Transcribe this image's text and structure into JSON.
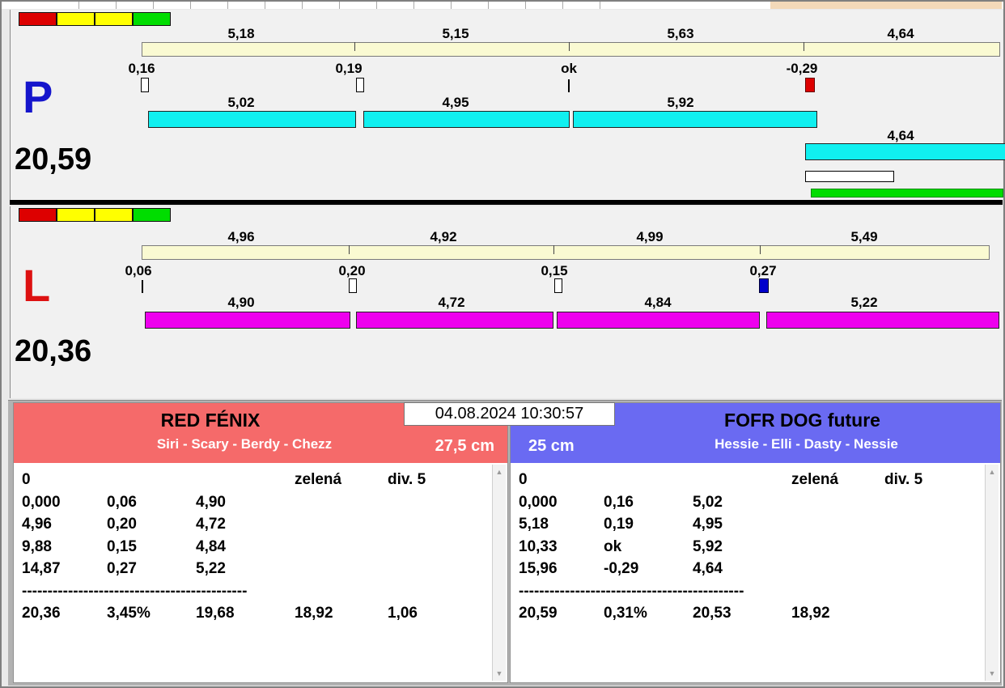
{
  "window": {
    "datetime": "04.08.2024 10:30:57"
  },
  "colors": {
    "lane_p_bar": "#10f0f0",
    "lane_l_bar": "#ee00ee",
    "segment_bar": "#fafad2",
    "ok_green": "#00dd00",
    "warn_yellow": "#ffff00",
    "fault_red": "#dd0000",
    "marker_blue": "#0000cc",
    "team_left_header": "#f56a6a",
    "team_right_header": "#6a6af2",
    "lane_p_letter": "#1515cc",
    "lane_l_letter": "#dd1111"
  },
  "lane_p": {
    "letter": "P",
    "total": "20,59",
    "status_lights": [
      "red",
      "yellow",
      "yellow",
      "green"
    ],
    "segment_times": [
      "5,18",
      "5,15",
      "5,63",
      "4,64"
    ],
    "change_times": [
      "0,16",
      "0,19",
      "ok",
      "-0,29"
    ],
    "run_times": [
      "5,02",
      "4,95",
      "5,92"
    ],
    "last_run_time": "4,64"
  },
  "lane_l": {
    "letter": "L",
    "total": "20,36",
    "status_lights": [
      "red",
      "yellow",
      "yellow",
      "green"
    ],
    "segment_times": [
      "4,96",
      "4,92",
      "4,99",
      "5,49"
    ],
    "change_times": [
      "0,06",
      "0,20",
      "0,15",
      "0,27"
    ],
    "run_times": [
      "4,90",
      "4,72",
      "4,84",
      "5,22"
    ]
  },
  "team_left": {
    "name": "RED FÉNIX",
    "dogs": "Siri - Scary - Berdy - Chezz",
    "height": "27,5 cm",
    "rows": {
      "r0": {
        "c1": "0",
        "c4": "zelená",
        "c5": "div. 5"
      },
      "r1": {
        "c1": "0,000",
        "c2": "0,06",
        "c3": "4,90"
      },
      "r2": {
        "c1": "4,96",
        "c2": "0,20",
        "c3": "4,72"
      },
      "r3": {
        "c1": "9,88",
        "c2": "0,15",
        "c3": "4,84"
      },
      "r4": {
        "c1": "14,87",
        "c2": "0,27",
        "c3": "5,22"
      },
      "dashes": "--------------------------------------------",
      "sum": {
        "c1": "20,36",
        "c2": "3,45%",
        "c3": "19,68",
        "c4": "18,92",
        "c5": "1,06"
      }
    }
  },
  "team_right": {
    "name": "FOFR DOG future",
    "dogs": "Hessie - Elli - Dasty - Nessie",
    "height": "25 cm",
    "rows": {
      "r0": {
        "c1": "0",
        "c4": "zelená",
        "c5": "div. 5"
      },
      "r1": {
        "c1": "0,000",
        "c2": "0,16",
        "c3": "5,02"
      },
      "r2": {
        "c1": "5,18",
        "c2": "0,19",
        "c3": "4,95"
      },
      "r3": {
        "c1": "10,33",
        "c2": "ok",
        "c3": "5,92"
      },
      "r4": {
        "c1": "15,96",
        "c2": "-0,29",
        "c3": "4,64"
      },
      "dashes": "--------------------------------------------",
      "sum": {
        "c1": "20,59",
        "c2": "0,31%",
        "c3": "20,53",
        "c4": "18,92"
      }
    }
  }
}
